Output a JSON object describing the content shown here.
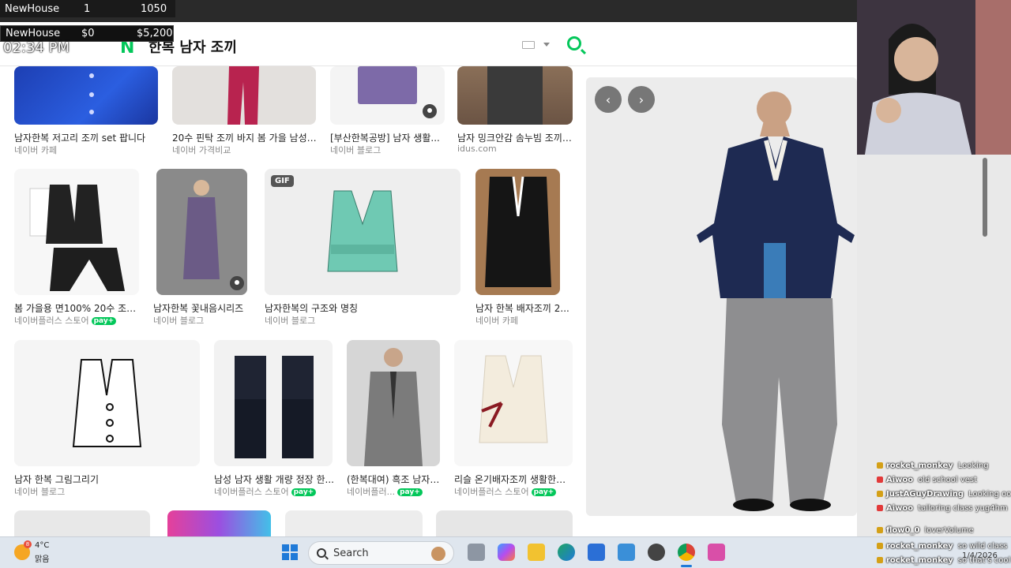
{
  "overlay": {
    "row1": {
      "name": "NewHouse",
      "count": "1",
      "value": "1050"
    },
    "row2": {
      "name": "NewHouse",
      "spent": "$0",
      "budget": "$5,200"
    },
    "time": "02:34 PM"
  },
  "header": {
    "logo": "N",
    "query": "한복 남자 조끼",
    "icons": [
      "keyboard-icon",
      "search-icon"
    ]
  },
  "results": {
    "row1": [
      {
        "caption": "남자한복 저고리 조끼 set 팝니다",
        "source": "네이버 카페"
      },
      {
        "caption": "20수 핀탁 조끼 바지 봄 가을 남성 ...",
        "source": "네이버 가격비교"
      },
      {
        "caption": "[부산한복공방] 남자 생활...",
        "source": "네이버 블로그"
      },
      {
        "caption": "남자 밍크안감 솜누빔 조끼 ...",
        "source": "idus.com"
      }
    ],
    "row2": [
      {
        "caption": "봄 가을용 면100% 20수 조끼...",
        "source": "네이버플러스 스토어",
        "pay": "pay+"
      },
      {
        "caption": "남자한복 꽃내음시리즈",
        "source": "네이버 블로그"
      },
      {
        "caption": "남자한복의 구조와 명칭",
        "source": "네이버 블로그",
        "badge": "GIF"
      },
      {
        "caption": "남자 한복 배자조끼 2...",
        "source": "네이버 카페"
      }
    ],
    "row3": [
      {
        "caption": "남자 한복 그림그리기",
        "source": "네이버 블로그"
      },
      {
        "caption": "남성 남자 생활 개량 정장 한...",
        "source": "네이버플러스 스토어",
        "pay": "pay+"
      },
      {
        "caption": "(한복대여) 흑조 남자 ...",
        "source": "네이버플러...",
        "pay": "pay+"
      },
      {
        "caption": "리슬 온기배자조끼 생활한복...",
        "source": "네이버플러스 스토어",
        "pay": "pay+"
      }
    ]
  },
  "viewer": {
    "prev": "‹",
    "next": "›"
  },
  "chat": [
    {
      "user": "rocket_monkey",
      "msg": "Looking"
    },
    {
      "user": "Aiwoo",
      "msg": "old school vest"
    },
    {
      "user": "JustAGuyDrawing",
      "msg": "Looking ooo"
    },
    {
      "user": "Aiwoo",
      "msg": "tailoring class yug4hm"
    },
    {
      "user": "flow0_0",
      "msg": "loverVolume"
    },
    {
      "user": "rocket_monkey",
      "msg": "so wild class"
    },
    {
      "user": "rocket_monkey",
      "msg": "so that's cool"
    }
  ],
  "taskbar": {
    "weather_badge": "8",
    "temperature": "4°C",
    "condition": "맑음",
    "search_label": "Search",
    "date_fragment": "1/4/2026"
  },
  "colors": {
    "naver_green": "#03c75a",
    "taskbar": "#dfe6ee"
  }
}
